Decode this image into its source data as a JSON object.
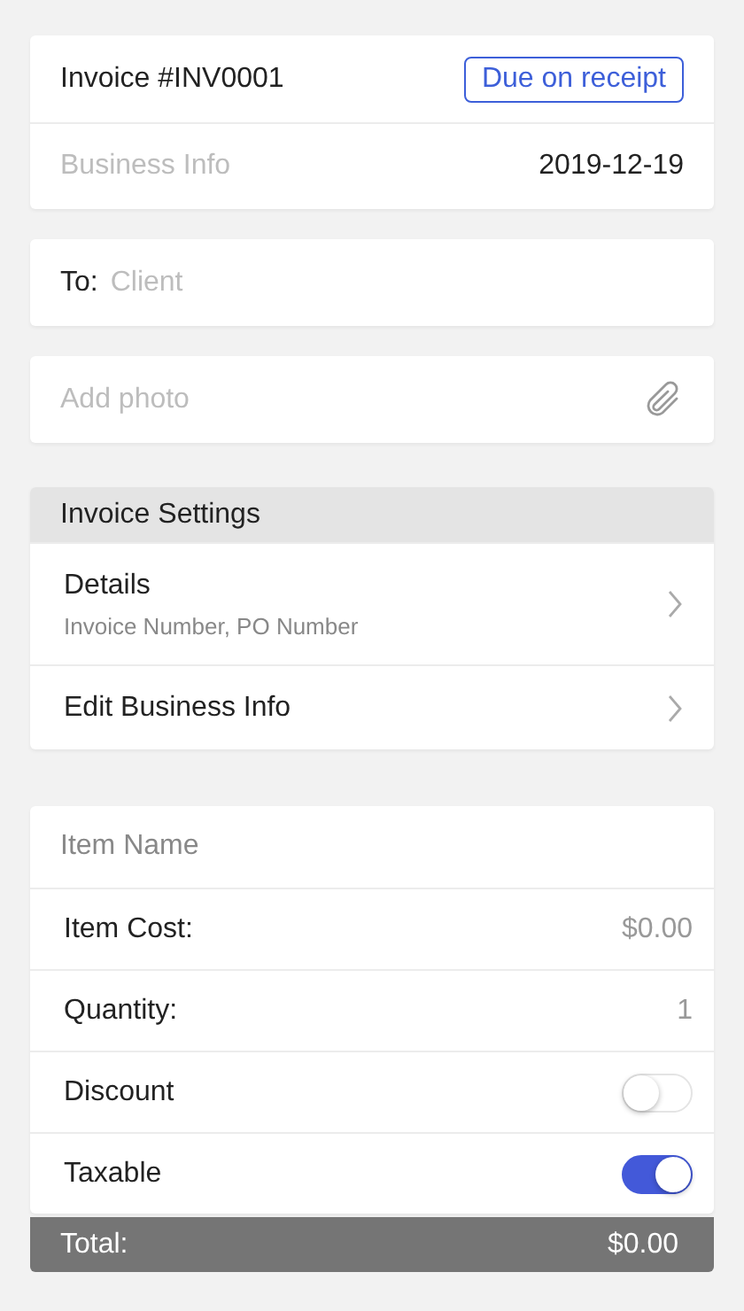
{
  "invoice": {
    "title": "Invoice #INV0001",
    "terms_button": "Due on receipt",
    "business_info": "Business Info",
    "date": "2019-12-19"
  },
  "recipient": {
    "label": "To:",
    "placeholder": "Client"
  },
  "photo": {
    "label": "Add photo"
  },
  "settings": {
    "header": "Invoice Settings",
    "items": [
      {
        "title": "Details",
        "subtitle": "Invoice Number, PO Number"
      },
      {
        "title": "Edit Business Info"
      }
    ]
  },
  "item": {
    "name_placeholder": "Item Name",
    "rows": [
      {
        "kind": "input",
        "label": "Item Cost:",
        "placeholder": "$0.00"
      },
      {
        "kind": "input",
        "label": "Quantity:",
        "placeholder": "1"
      },
      {
        "kind": "toggle",
        "label": "Discount",
        "on": false
      },
      {
        "kind": "toggle",
        "label": "Taxable",
        "on": true
      }
    ],
    "total_label": "Total:",
    "total_value": "$0.00"
  }
}
